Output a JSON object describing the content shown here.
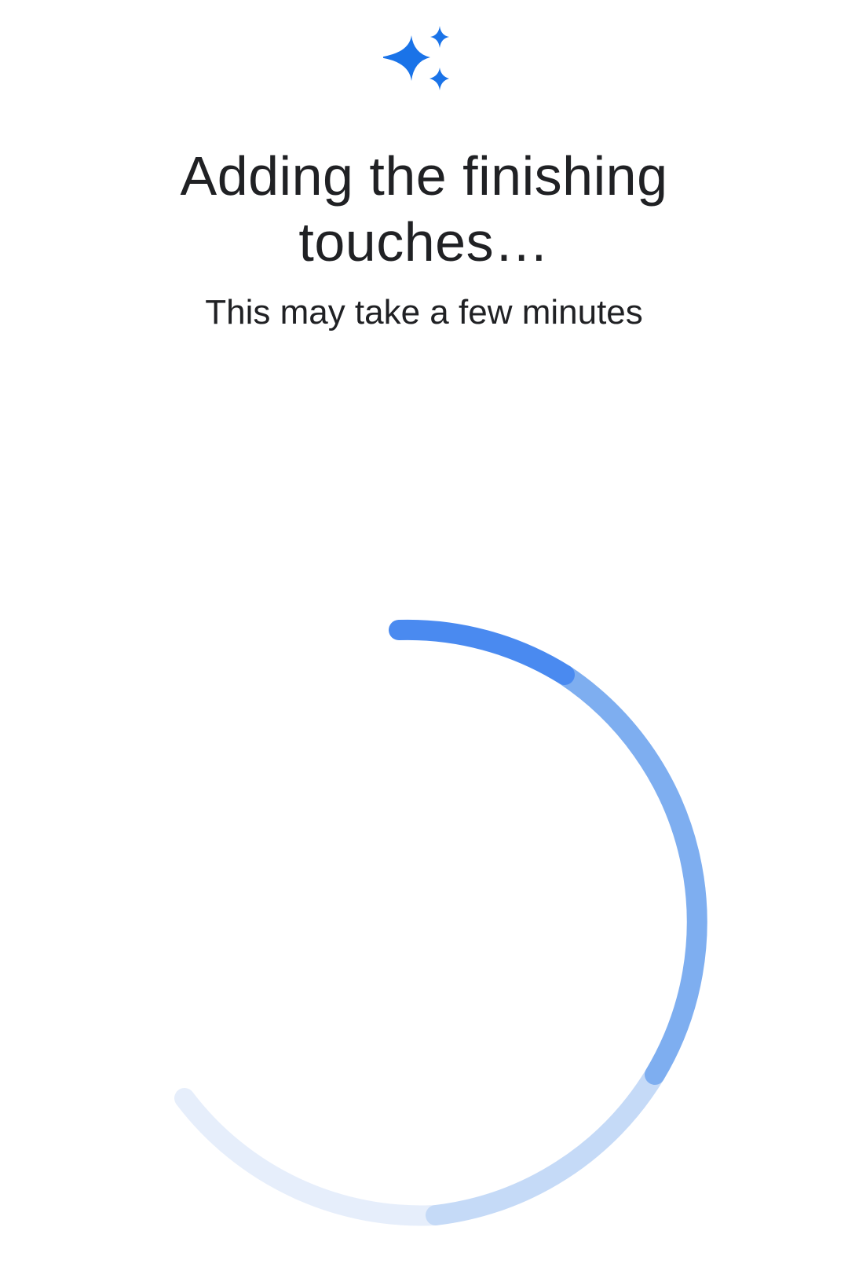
{
  "header": {
    "icon": "sparkle-icon",
    "title": "Adding the finishing touches…",
    "subtitle": "This may take a few minutes"
  },
  "spinner": {
    "icon": "progress-spinner",
    "colors": {
      "segment_1": "#4a8af0",
      "segment_2": "#7eaef0",
      "segment_3": "#c5daf7",
      "segment_4": "#e6eefb"
    }
  },
  "colors": {
    "accent": "#1a73e8",
    "text": "#202124",
    "background": "#ffffff"
  }
}
